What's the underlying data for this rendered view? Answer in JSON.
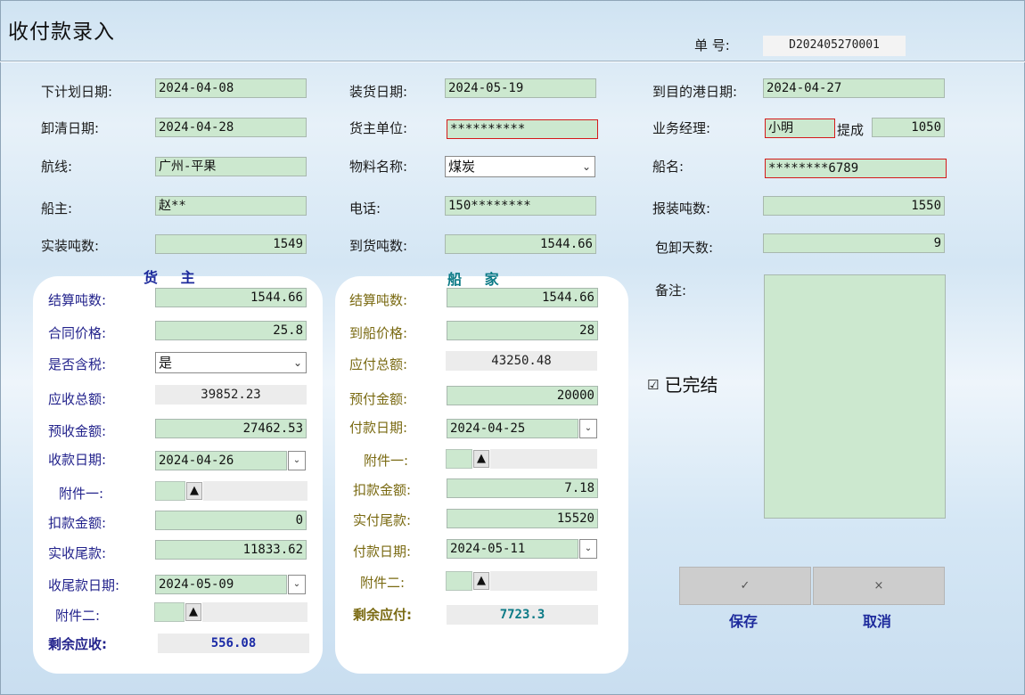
{
  "window": {
    "title": "收付款录入"
  },
  "order": {
    "label": "单  号:",
    "value": "D202405270001"
  },
  "top": {
    "plan_date_label": "下计划日期:",
    "plan_date": "2024-04-08",
    "load_date_label": "装货日期:",
    "load_date": "2024-05-19",
    "arrive_date_label": "到目的港日期:",
    "arrive_date": "2024-04-27",
    "unload_date_label": "卸清日期:",
    "unload_date": "2024-04-28",
    "shipper_label": "货主单位:",
    "shipper": "**********",
    "manager_label": "业务经理:",
    "manager": "小明",
    "commission_label": "提成",
    "commission": "1050",
    "route_label": "航线:",
    "route": "广州-平果",
    "material_label": "物料名称:",
    "material": "煤炭",
    "ship_name_label": "船名:",
    "ship_name": "********6789",
    "owner_label": "船主:",
    "owner": "赵**",
    "phone_label": "电话:",
    "phone": "150********",
    "declared_tons_label": "报装吨数:",
    "declared_tons": "1550",
    "actual_tons_label": "实装吨数:",
    "actual_tons": "1549",
    "arrived_tons_label": "到货吨数:",
    "arrived_tons": "1544.66",
    "days_label": "包卸天数:",
    "days": "9"
  },
  "cargo": {
    "title": "货 主",
    "settle_tons_label": "结算吨数:",
    "settle_tons": "1544.66",
    "price_label": "合同价格:",
    "price": "25.8",
    "tax_label": "是否含税:",
    "tax": "是",
    "total_label": "应收总额:",
    "total": "39852.23",
    "prepaid_label": "预收金额:",
    "prepaid": "27462.53",
    "receive_date_label": "收款日期:",
    "receive_date": "2024-04-26",
    "att1_label": "附件一:",
    "deduct_label": "扣款金额:",
    "deduct": "0",
    "balance_label": "实收尾款:",
    "balance": "11833.62",
    "balance_date_label": "收尾款日期:",
    "balance_date": "2024-05-09",
    "att2_label": "附件二:",
    "remain_label": "剩余应收:",
    "remain": "556.08"
  },
  "ship": {
    "title": "船 家",
    "settle_tons_label": "结算吨数:",
    "settle_tons": "1544.66",
    "price_label": "到船价格:",
    "price": "28",
    "total_label": "应付总额:",
    "total": "43250.48",
    "prepaid_label": "预付金额:",
    "prepaid": "20000",
    "pay_date_label": "付款日期:",
    "pay_date": "2024-04-25",
    "att1_label": "附件一:",
    "deduct_label": "扣款金额:",
    "deduct": "7.18",
    "balance_label": "实付尾款:",
    "balance": "15520",
    "pay_date2_label": "付款日期:",
    "pay_date2": "2024-05-11",
    "att2_label": "附件二:",
    "remain_label": "剩余应付:",
    "remain": "7723.3"
  },
  "notes": {
    "label": "备注:"
  },
  "completed": {
    "label": "已完结",
    "checked": true
  },
  "actions": {
    "save_label": "保存",
    "cancel_label": "取消",
    "save_icon": "✓",
    "cancel_icon": "×"
  }
}
